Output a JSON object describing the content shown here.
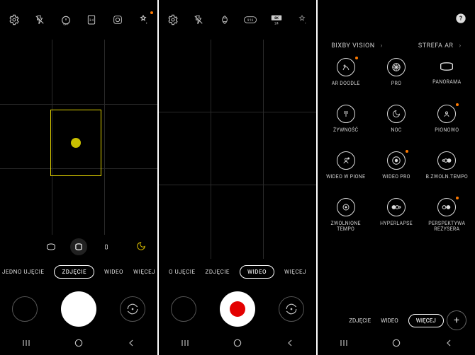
{
  "screen1": {
    "top": {
      "settings": "settings",
      "flash": "flash-off",
      "timer": "timer-off",
      "ratio": "3:4",
      "motion": "motion-photo",
      "filters": "filters"
    },
    "modes": {
      "m0": "JEDNO UJĘCIE",
      "m1": "ZDJĘCIE",
      "m2": "WIDEO",
      "m3": "WIĘCEJ"
    },
    "nav": {
      "recent": "|||",
      "home": "○",
      "back": "‹"
    }
  },
  "screen2": {
    "top": {
      "settings": "settings",
      "flash": "flash-off",
      "superst": "super-steady",
      "ratio": "9:16",
      "res": "8K 24",
      "filters": "filters"
    },
    "modes": {
      "m0": "O UJĘCIE",
      "m1": "ZDJĘCIE",
      "m2": "WIDEO",
      "m3": "WIĘCEJ"
    },
    "nav": {
      "recent": "|||",
      "home": "○",
      "back": "‹"
    }
  },
  "screen3": {
    "headers": {
      "h0": "BIXBY VISION",
      "h1": "STREFA AR"
    },
    "grid": [
      {
        "label": "AR DOODLE",
        "dot": true
      },
      {
        "label": "PRO",
        "dot": false
      },
      {
        "label": "PANORAMA",
        "dot": false
      },
      {
        "label": "ŻYWNOŚĆ",
        "dot": false
      },
      {
        "label": "NOC",
        "dot": false
      },
      {
        "label": "PIONOWO",
        "dot": true
      },
      {
        "label": "WIDEO W PIONE",
        "dot": false
      },
      {
        "label": "WIDEO PRO",
        "dot": true
      },
      {
        "label": "B.ZWOLN.TEMPO",
        "dot": false
      },
      {
        "label": "ZWOLNIONE TEMPO",
        "dot": false
      },
      {
        "label": "HYPERLAPSE",
        "dot": false
      },
      {
        "label": "PERSPEKTYWA REŻYSERA",
        "dot": true
      }
    ],
    "modes": {
      "m0": "ZDJĘCIE",
      "m1": "WIDEO",
      "m2": "WIĘCEJ"
    },
    "nav": {
      "recent": "|||",
      "home": "○",
      "back": "‹"
    }
  }
}
